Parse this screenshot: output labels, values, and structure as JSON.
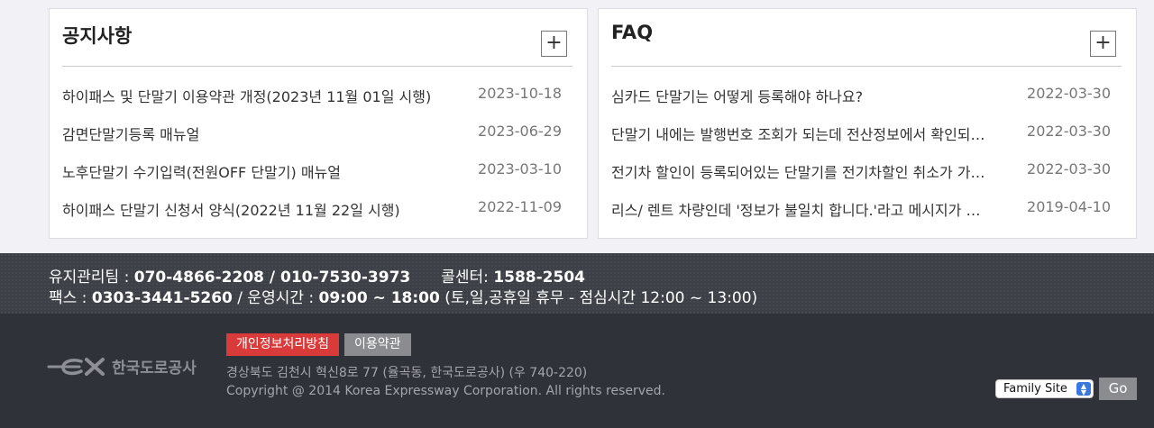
{
  "notice": {
    "title": "공지사항",
    "more_label": "+",
    "items": [
      {
        "title": "하이패스 및 단말기 이용약관 개정(2023년 11월 01일 시행)",
        "date": "2023-10-18"
      },
      {
        "title": "감면단말기등록 매뉴얼",
        "date": "2023-06-29"
      },
      {
        "title": "노후단말기 수기입력(전원OFF 단말기) 매뉴얼",
        "date": "2023-03-10"
      },
      {
        "title": "하이패스 단말기 신청서 양식(2022년 11월 22일 시행)",
        "date": "2022-11-09"
      }
    ]
  },
  "faq": {
    "title": "FAQ",
    "more_label": "+",
    "items": [
      {
        "title": "심카드 단말기는 어떻게 등록해야 하나요?",
        "date": "2022-03-30"
      },
      {
        "title": "단말기 내에는 발행번호 조회가 되는데 전산정보에서 확인되…",
        "date": "2022-03-30"
      },
      {
        "title": "전기차 할인이 등록되어있는 단말기를 전기차할인 취소가 가…",
        "date": "2022-03-30"
      },
      {
        "title": "리스/ 렌트 차량인데 '정보가 불일치 합니다.'라고 메시지가 나…",
        "date": "2019-04-10"
      }
    ]
  },
  "contact": {
    "maint_label": "유지관리팀 : ",
    "maint_phone": "070-4866-2208 / 010-7530-3973",
    "call_label": "콜센터: ",
    "call_phone": "1588-2504",
    "fax_label": "팩스 : ",
    "fax_number": "0303-3441-5260",
    "hours_label": " / 운영시간 : ",
    "hours_value": "09:00 ~ 18:00",
    "hours_note": " (토,일,공휴일 휴무 - 점심시간 12:00 ~ 13:00)"
  },
  "footer": {
    "logo_text": "한국도로공사",
    "privacy_label": "개인정보처리방침",
    "terms_label": "이용약관",
    "address": "경상북도 김천시 혁신8로 77 (율곡동, 한국도로공사) (우 740-220)",
    "copyright": "Copyright @ 2014 Korea Expressway Corporation. All rights reserved.",
    "family_site_label": "Family Site",
    "go_label": "Go"
  },
  "colors": {
    "privacy_button": "#d93a3a",
    "terms_button": "#8a8c90",
    "footer_top": "#3d4046",
    "footer_bottom": "#30323a"
  }
}
